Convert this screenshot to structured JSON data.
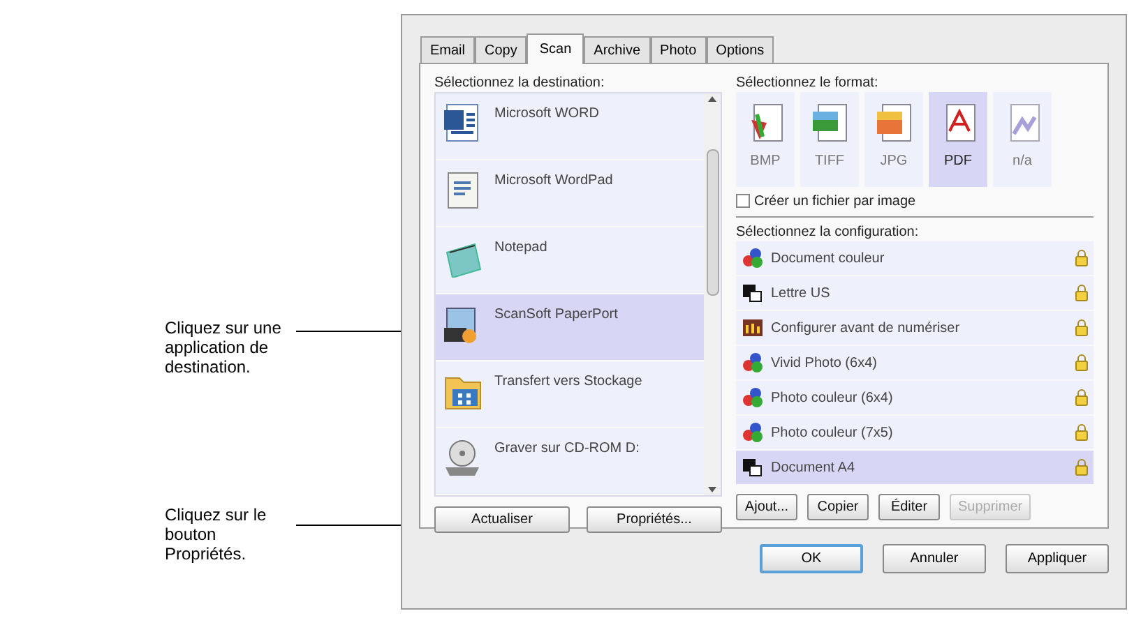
{
  "callouts": [
    {
      "text": "Cliquez sur une application de destination."
    },
    {
      "text": "Cliquez sur le bouton Propriétés."
    }
  ],
  "tabs": [
    {
      "label": "Email",
      "selected": false
    },
    {
      "label": "Copy",
      "selected": false
    },
    {
      "label": "Scan",
      "selected": true
    },
    {
      "label": "Archive",
      "selected": false
    },
    {
      "label": "Photo",
      "selected": false
    },
    {
      "label": "Options",
      "selected": false
    }
  ],
  "destination": {
    "label": "Sélectionnez la destination:",
    "items": [
      {
        "name": "Microsoft WORD",
        "selected": false
      },
      {
        "name": "Microsoft WordPad",
        "selected": false
      },
      {
        "name": "Notepad",
        "selected": false
      },
      {
        "name": "ScanSoft PaperPort",
        "selected": true
      },
      {
        "name": "Transfert vers Stockage",
        "selected": false
      },
      {
        "name": "Graver sur CD-ROM  D:",
        "selected": false
      }
    ],
    "buttons": [
      {
        "label": "Actualiser",
        "disabled": false
      },
      {
        "label": "Propriétés...",
        "disabled": false
      }
    ]
  },
  "format": {
    "label": "Sélectionnez le format:",
    "items": [
      {
        "label": "BMP",
        "selected": false
      },
      {
        "label": "TIFF",
        "selected": false
      },
      {
        "label": "JPG",
        "selected": false
      },
      {
        "label": "PDF",
        "selected": true
      },
      {
        "label": "n/a",
        "selected": false
      }
    ],
    "checkbox": {
      "label": "Créer un fichier par image",
      "checked": false
    }
  },
  "configuration": {
    "label": "Sélectionnez la configuration:",
    "items": [
      {
        "name": "Document couleur",
        "selected": false
      },
      {
        "name": "Lettre US",
        "selected": false
      },
      {
        "name": "Configurer avant de numériser",
        "selected": false
      },
      {
        "name": "Vivid Photo (6x4)",
        "selected": false
      },
      {
        "name": "Photo couleur (6x4)",
        "selected": false
      },
      {
        "name": "Photo couleur (7x5)",
        "selected": false
      },
      {
        "name": "Document A4",
        "selected": true
      }
    ],
    "buttons": [
      {
        "label": "Ajout...",
        "disabled": false
      },
      {
        "label": "Copier",
        "disabled": false
      },
      {
        "label": "Éditer",
        "disabled": false
      },
      {
        "label": "Supprimer",
        "disabled": true
      }
    ]
  },
  "dialog_buttons": [
    {
      "label": "OK",
      "default": true
    },
    {
      "label": "Annuler",
      "default": false
    },
    {
      "label": "Appliquer",
      "default": false
    }
  ]
}
